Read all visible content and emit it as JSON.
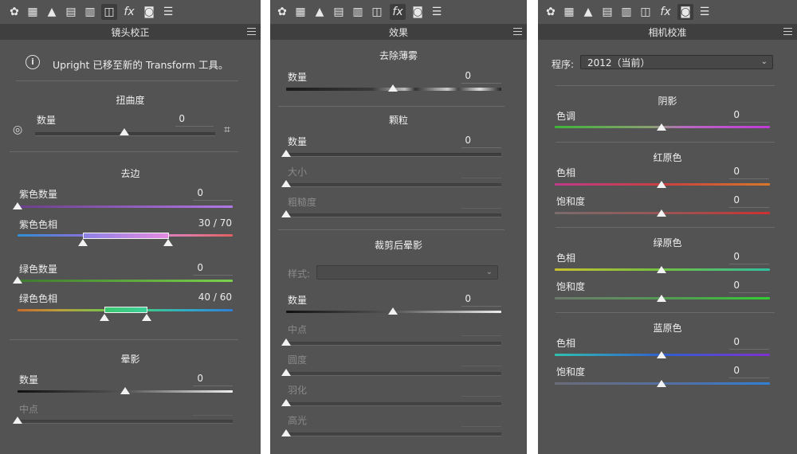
{
  "panels": [
    {
      "title": "镜头校正",
      "info_text": "Upright 已移至新的 Transform 工具。",
      "distortion": {
        "heading": "扭曲度",
        "amount_label": "数量",
        "amount_value": "0"
      },
      "fringe": {
        "heading": "去边",
        "purple_amount_label": "紫色数量",
        "purple_amount_value": "0",
        "purple_hue_label": "紫色色相",
        "purple_hue_value": "30 / 70",
        "green_amount_label": "绿色数量",
        "green_amount_value": "0",
        "green_hue_label": "绿色色相",
        "green_hue_value": "40 / 60"
      },
      "vignette": {
        "heading": "晕影",
        "amount_label": "数量",
        "amount_value": "0",
        "midpoint_label": "中点"
      }
    },
    {
      "title": "效果",
      "dehaze": {
        "heading": "去除薄雾",
        "amount_label": "数量",
        "amount_value": "0"
      },
      "grain": {
        "heading": "颗粒",
        "amount_label": "数量",
        "amount_value": "0",
        "size_label": "大小",
        "roughness_label": "粗糙度"
      },
      "post_crop": {
        "heading": "裁剪后晕影",
        "style_label": "样式:",
        "amount_label": "数量",
        "amount_value": "0",
        "midpoint_label": "中点",
        "roundness_label": "圆度",
        "feather_label": "羽化",
        "highlights_label": "高光"
      }
    },
    {
      "title": "相机校准",
      "process_label": "程序:",
      "process_value": "2012（当前）",
      "shadows": {
        "heading": "阴影",
        "tint_label": "色调",
        "tint_value": "0"
      },
      "red": {
        "heading": "红原色",
        "hue_label": "色相",
        "hue_value": "0",
        "sat_label": "饱和度",
        "sat_value": "0"
      },
      "green": {
        "heading": "绿原色",
        "hue_label": "色相",
        "hue_value": "0",
        "sat_label": "饱和度",
        "sat_value": "0"
      },
      "blue": {
        "heading": "蓝原色",
        "hue_label": "色相",
        "hue_value": "0",
        "sat_label": "饱和度",
        "sat_value": "0"
      }
    }
  ],
  "toolbar_icons": [
    "basic-icon",
    "tone-curve-icon",
    "detail-icon",
    "hsl-icon",
    "split-toning-icon",
    "lens-corrections-icon",
    "effects-icon",
    "camera-calibration-icon",
    "presets-icon"
  ],
  "colors": {
    "panel_bg": "#535353",
    "titlebar_bg": "#3f3f3f",
    "text": "#e6e6e6"
  }
}
